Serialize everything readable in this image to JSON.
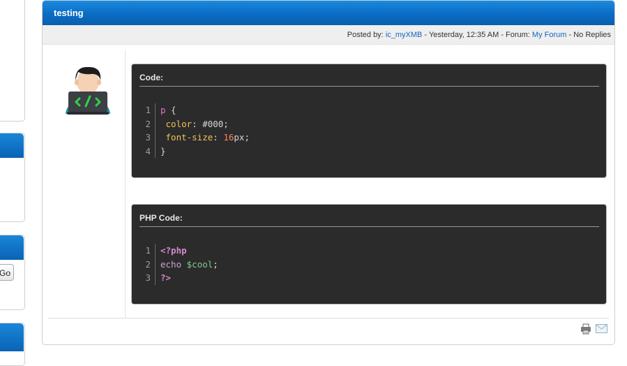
{
  "post": {
    "title": "testing",
    "meta": {
      "posted_by_label": "Posted by: ",
      "author": "ic_myXMB",
      "date_sep": " - ",
      "date": "Yesterday, 12:35 AM",
      "forum_label": " - Forum: ",
      "forum": "My Forum",
      "replies": " - No Replies"
    },
    "code_block": {
      "label": "Code:",
      "lines": [
        {
          "num": "1",
          "parts": [
            {
              "t": "p",
              "c": "t-sel"
            },
            {
              "t": " {",
              "c": ""
            }
          ]
        },
        {
          "num": "2",
          "parts": [
            {
              "t": " color",
              "c": "t-prop"
            },
            {
              "t": ": #000;",
              "c": ""
            }
          ]
        },
        {
          "num": "3",
          "parts": [
            {
              "t": " font-size",
              "c": "t-prop"
            },
            {
              "t": ": ",
              "c": ""
            },
            {
              "t": "16",
              "c": "t-num"
            },
            {
              "t": "px;",
              "c": ""
            }
          ]
        },
        {
          "num": "4",
          "parts": [
            {
              "t": "}",
              "c": ""
            }
          ]
        }
      ]
    },
    "php_block": {
      "label": "PHP Code:",
      "lines": [
        {
          "num": "1",
          "parts": [
            {
              "t": "<?php",
              "c": "t-kw"
            }
          ]
        },
        {
          "num": "2",
          "parts": [
            {
              "t": "echo ",
              "c": "t-echo"
            },
            {
              "t": "$cool",
              "c": "t-var"
            },
            {
              "t": ";",
              "c": ""
            }
          ]
        },
        {
          "num": "3",
          "parts": [
            {
              "t": "?>",
              "c": "t-kw"
            }
          ]
        }
      ]
    }
  },
  "sidebar": {
    "go_label": "Go"
  },
  "colors": {
    "header_blue": "#0b6cc4",
    "link": "#1565c0",
    "code_bg": "#2b2b2b"
  },
  "icons": [
    "avatar-coder-icon",
    "print-icon",
    "email-icon"
  ]
}
